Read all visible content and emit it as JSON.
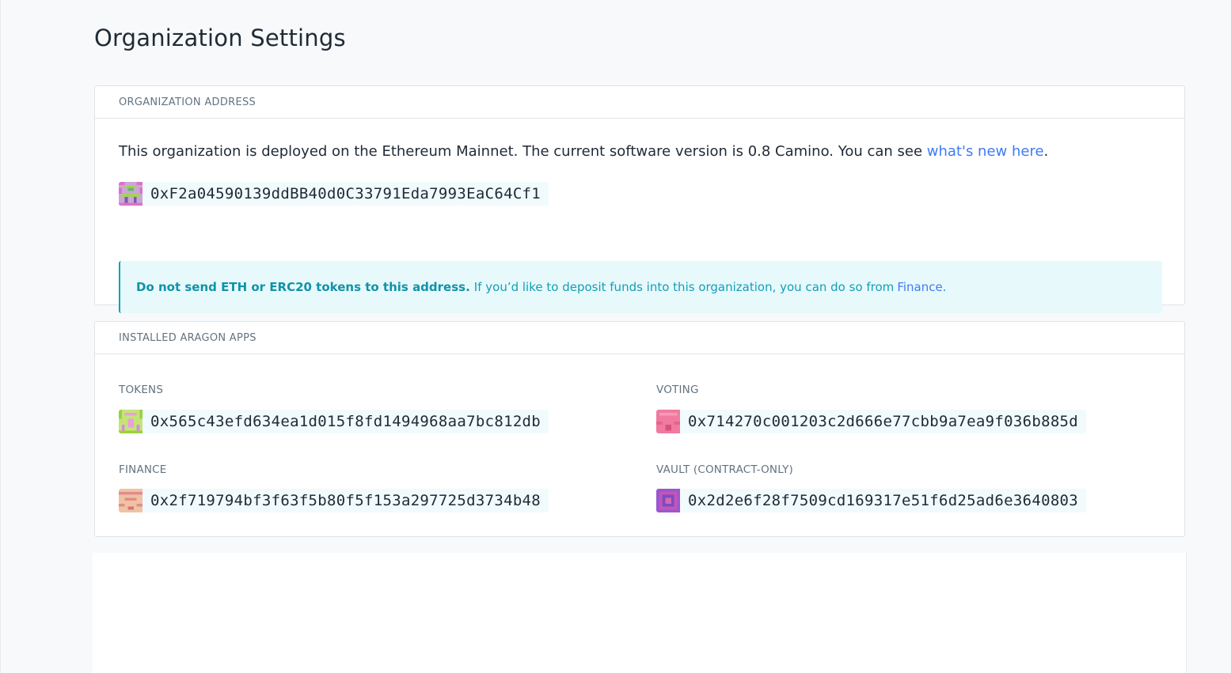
{
  "page": {
    "title": "Organization Settings"
  },
  "organization_address": {
    "header": "ORGANIZATION ADDRESS",
    "deploy_text": "This organization is deployed on the Ethereum Mainnet. The current software version is 0.8 Camino. You can see ",
    "whats_new_link": "what's new here",
    "deploy_text_end": ".",
    "address": "0xF2a04590139ddBB40d0C33791Eda7993EaC64Cf1",
    "identicon": "identicon-org",
    "warning": {
      "strong": "Do not send ETH or ERC20 tokens to this address.",
      "text": "If you’d like to deposit funds into this organization, you can do so from ",
      "link": "Finance",
      "end": "."
    }
  },
  "installed_apps": {
    "header": "INSTALLED ARAGON APPS",
    "apps": [
      {
        "label": "TOKENS",
        "address": "0x565c43efd634ea1d015f8fd1494968aa7bc812db"
      },
      {
        "label": "VOTING",
        "address": "0x714270c001203c2d666e77cbb9a7ea9f036b885d"
      },
      {
        "label": "FINANCE",
        "address": "0x2f719794bf3f63f5b80f5f153a297725d3734b48"
      },
      {
        "label": "VAULT (CONTRACT-ONLY)",
        "address": "0x2d2e6f28f7509cd169317e51f6d25ad6e3640803"
      }
    ]
  },
  "colors": {
    "accent_link": "#3e7bf6",
    "warning_text": "#12a0b7",
    "warning_bg": "#e8f9fc",
    "address_bg": "#f1fbfd"
  }
}
